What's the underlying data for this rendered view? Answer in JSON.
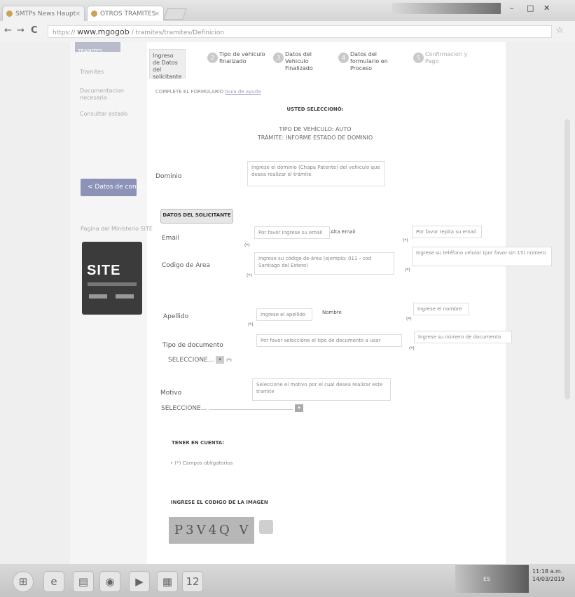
{
  "browser": {
    "tabs": [
      {
        "label": "SMTPs News Haupt",
        "close": "×"
      },
      {
        "label": "OTROS TRAMITES",
        "close": "×"
      }
    ],
    "url_host": "www.mgogob",
    "url_path": "tramites/tramites/Definicion",
    "nav": {
      "back": "←",
      "forward": "→",
      "reload": "C"
    }
  },
  "sidebar": {
    "top_button": "TRAMITES",
    "links": [
      "Tramites",
      "Documentacion necesaria",
      "Consultar estado"
    ],
    "contact_button": "< Datos de contacto",
    "contact_info": "Pagina del Ministerio SITE",
    "logo_text": "SITE"
  },
  "steps": [
    {
      "num": "1",
      "label": "Ingreso de Datos del solicitante"
    },
    {
      "num": "2",
      "label": "Tipo de vehiculo finalizado"
    },
    {
      "num": "3",
      "label": "Datos del Vehiculo Finalizado"
    },
    {
      "num": "4",
      "label": "Datos del formulario en Proceso"
    },
    {
      "num": "5",
      "label": "Confirmacion y Pago"
    }
  ],
  "form": {
    "subtitle": "COMPLETE EL FORMULARIO",
    "subtitle_link": "Guia de ayuda",
    "header": "USTED SELECCIONÓ:",
    "line1": "TIPO DE VEHÍCULO: AUTO",
    "line2": "TRÁMITE: INFORME ESTADO DE DOMINIO",
    "dominio_label": "Dominio",
    "dominio_help": "Ingrese el dominio (Chapa Patente) del vehículo que desea realizar el trámite",
    "datos_button": "DATOS DEL SOLICITANTE",
    "email_label": "Email",
    "email_placeholder": "Por favor ingrese su email",
    "email_side_label": "Alta Email",
    "email_confirm_placeholder": "Por favor repita su email",
    "codigo_label": "Codigo de Area",
    "codigo_help": "Ingrese su código de área (ejemplo: 011 - cod Santiago del Estero)",
    "telefono_help": "Ingrese su teléfono celular (por favor sin 15) número",
    "apellido_label": "Apellido",
    "apellido_placeholder": "Ingrese el apellido",
    "nombre_label": "Nombre",
    "nombre_placeholder": "Ingrese el nombre",
    "tipo_doc_label": "Tipo de documento",
    "tipo_doc_help": "Por favor seleccione el tipo de documento a usar",
    "nro_doc_help": "Ingrese su número de documento",
    "tipo_doc_select": "SELECCIONE...",
    "motivo_label": "Motivo",
    "motivo_help": "Seleccione el motivo por el cual desea realizar este tramite",
    "motivo_select": "SELECCIONE...",
    "tener_title": "TENER EN CUENTA:",
    "tener_item": "• (*) Campos obligatorios",
    "codigo_title": "INGRESE EL CODIGO DE LA IMAGEN",
    "captcha_text": "P3V4Q V",
    "required_mark": "(*)"
  },
  "taskbar": {
    "time": "11:18 a.m.",
    "date": "14/03/2019",
    "lang": "ES"
  }
}
